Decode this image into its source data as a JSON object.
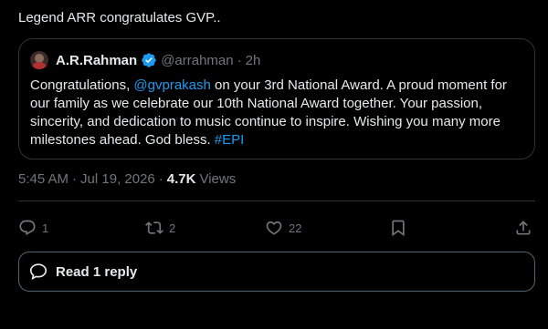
{
  "post": {
    "text": "Legend ARR congratulates GVP.."
  },
  "quote": {
    "author_name": "A.R.Rahman",
    "handle": "@arrahman",
    "time": "2h",
    "body_before": "Congratulations, ",
    "mention": "@gvprakash",
    "body_after": " on your 3rd National Award. A proud moment for our family as we celebrate our 10th National Award together. Your passion, sincerity, and dedication to music continue to inspire. Wishing you many more milestones ahead. God bless. ",
    "hashtag": "#EPI"
  },
  "meta": {
    "time": "5:45 AM",
    "date": "Jul 19, 2026",
    "views_count": "4.7K",
    "views_label": "Views"
  },
  "actions": {
    "replies": "1",
    "reposts": "2",
    "likes": "22"
  },
  "reply_button": {
    "label": "Read 1 reply"
  },
  "colors": {
    "accent": "#1d9bf0",
    "muted": "#71767b",
    "text": "#e7e9ea",
    "border": "#2f3336",
    "verified": "#1d9bf0"
  },
  "icons": [
    "verified-badge-icon",
    "reply-icon",
    "repost-icon",
    "like-icon",
    "bookmark-icon",
    "share-icon",
    "chat-bubble-icon"
  ]
}
